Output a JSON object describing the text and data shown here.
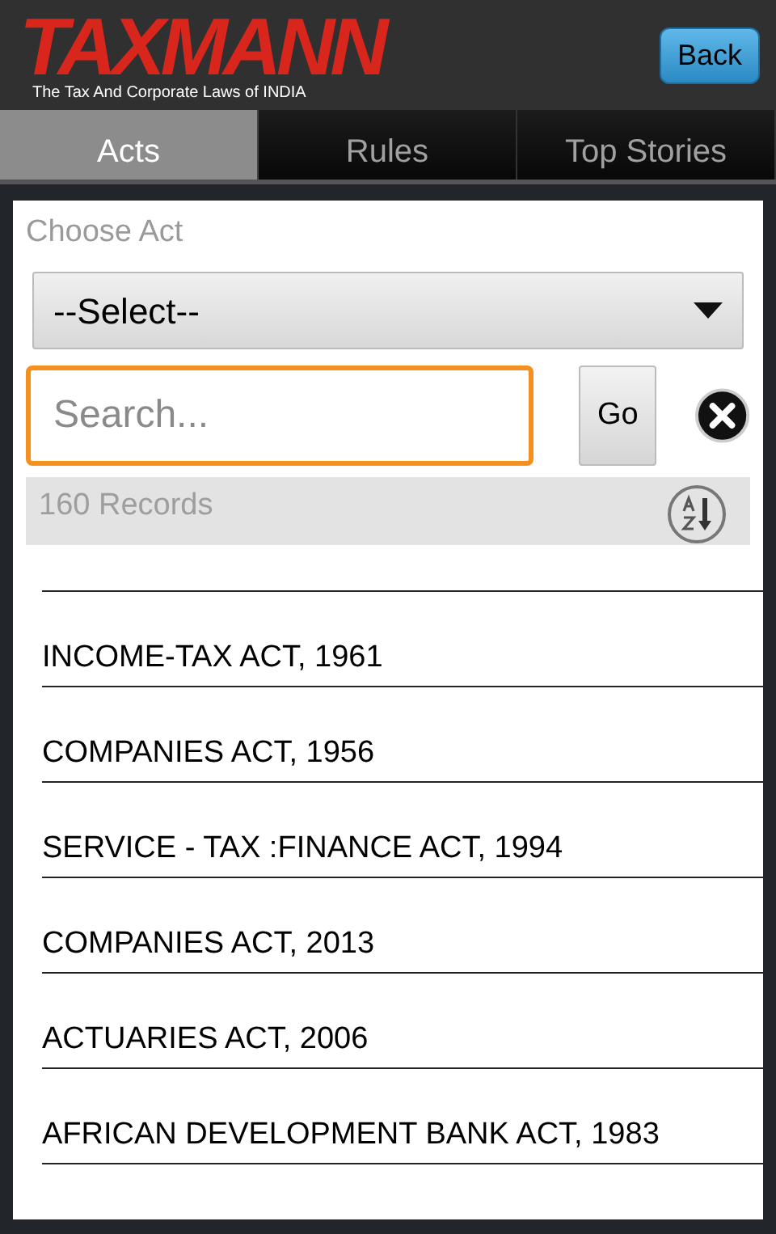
{
  "header": {
    "logo": "TAXMANN",
    "tagline": "The Tax And Corporate Laws of  INDIA",
    "back_button": "Back"
  },
  "tabs": [
    {
      "label": "Acts",
      "selected": true
    },
    {
      "label": "Rules",
      "selected": false
    },
    {
      "label": "Top Stories",
      "selected": false
    }
  ],
  "filter": {
    "label": "Choose Act",
    "dropdown": "--Select--",
    "search": {
      "placeholder": "Search..."
    },
    "go_button": "Go"
  },
  "records": {
    "count": "160 Records"
  },
  "acts": [
    "INCOME-TAX ACT, 1961",
    "COMPANIES ACT, 1956",
    "SERVICE - TAX :FINANCE ACT, 1994",
    "COMPANIES ACT, 2013",
    "ACTUARIES ACT, 2006",
    "AFRICAN DEVELOPMENT BANK ACT, 1983"
  ]
}
